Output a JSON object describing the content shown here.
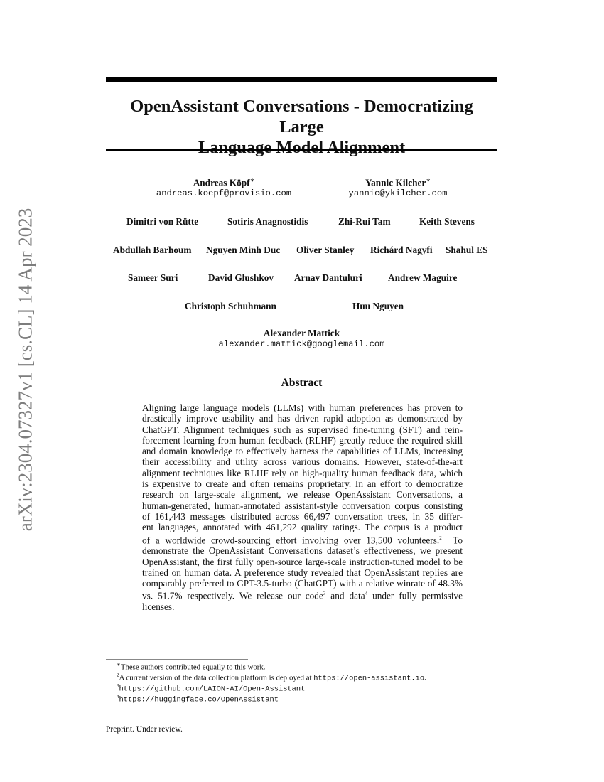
{
  "arxiv_stamp": "arXiv:2304.07327v1  [cs.CL]  14 Apr 2023",
  "title_line1": "OpenAssistant Conversations - Democratizing Large",
  "title_line2": "Language Model Alignment",
  "authors": {
    "row1": [
      {
        "name": "Andreas Köpf",
        "mark": "∗",
        "email": "andreas.koepf@provisio.com"
      },
      {
        "name": "Yannic Kilcher",
        "mark": "∗",
        "email": "yannic@ykilcher.com"
      }
    ],
    "row2": [
      "Dimitri von Rütte",
      "Sotiris Anagnostidis",
      "Zhi-Rui Tam",
      "Keith Stevens"
    ],
    "row3": [
      "Abdullah Barhoum",
      "Nguyen Minh Duc",
      "Oliver Stanley",
      "Richárd Nagyfi",
      "Shahul ES"
    ],
    "row4": [
      "Sameer Suri",
      "David Glushkov",
      "Arnav Dantuluri",
      "Andrew Maguire"
    ],
    "row5": [
      "Christoph Schuhmann",
      "Huu Nguyen"
    ],
    "last": {
      "name": "Alexander Mattick",
      "email": "alexander.mattick@googlemail.com"
    }
  },
  "abstract": {
    "heading": "Abstract",
    "lines": [
      "Aligning large language models (LLMs) with human preferences has proven to",
      "drastically improve usability and has driven rapid adoption as demonstrated by",
      "ChatGPT. Alignment techniques such as supervised fine-tuning (SFT) and rein-",
      "forcement learning from human feedback (RLHF) greatly reduce the required skill",
      "and domain knowledge to effectively harness the capabilities of LLMs, increasing",
      "their accessibility and utility across various domains.  However, state-of-the-art",
      "alignment techniques like RLHF rely on high-quality human feedback data, which",
      "is expensive to create and often remains proprietary.  In an effort to democratize",
      "research on large-scale alignment, we release OpenAssistant Conversations, a",
      "human-generated, human-annotated assistant-style conversation corpus consisting",
      "of 161,443 messages distributed across 66,497 conversation trees, in 35 differ-",
      "ent languages, annotated with 461,292 quality ratings.  The corpus is a product",
      "of a worldwide crowd-sourcing effort involving over 13,500 volunteers.",
      "demonstrate the OpenAssistant Conversations dataset’s effectiveness, we present",
      "OpenAssistant, the first fully open-source large-scale instruction-tuned model to be",
      "trained on human data. A preference study revealed that OpenAssistant replies are",
      "comparably preferred to GPT-3.5-turbo (ChatGPT) with a relative winrate of 48.3%",
      "vs.  51.7% respectively.  We release our code",
      "licenses."
    ],
    "line13_sup": "2",
    "line13_tail": "To",
    "line18_sup1": "3",
    "line18_mid": " and data",
    "line18_sup2": "4",
    "line18_tail": " under fully permissive"
  },
  "footnotes": [
    {
      "mark": "∗",
      "text": "These authors contributed equally to this work."
    },
    {
      "mark": "2",
      "text": "A current version of the data collection platform is deployed at ",
      "url": "https://open-assistant.io",
      "after": "."
    },
    {
      "mark": "3",
      "url": "https://github.com/LAION-AI/Open-Assistant"
    },
    {
      "mark": "4",
      "url": "https://huggingface.co/OpenAssistant"
    }
  ],
  "preprint_note": "Preprint. Under review."
}
